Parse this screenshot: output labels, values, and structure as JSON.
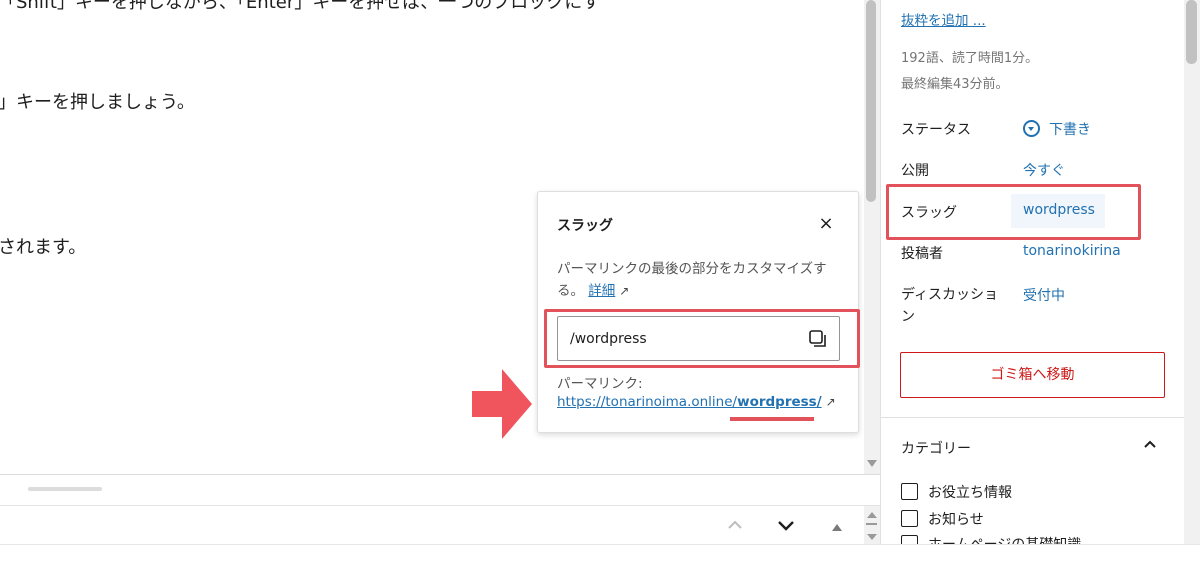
{
  "editor": {
    "line1": "「Shift」キーを押しながら、「Enter」キーを押せば、一つのブロックにす",
    "line2": "」キーを押しましょう。",
    "line3": "されます。"
  },
  "popover": {
    "title": "スラッグ",
    "close_icon": "×",
    "help_text": "パーマリンクの最後の部分をカスタマイズする。",
    "help_link": "詳細",
    "slug_value": "/wordpress",
    "permalink_label": "パーマリンク:",
    "permalink_base": "https://tonarinoima.online/",
    "permalink_slug": "wordpress/"
  },
  "sidebar": {
    "excerpt_link": "抜粋を追加 ...",
    "word_count": "192語、読了時間1分。",
    "last_edited": "最終編集43分前。",
    "rows": [
      {
        "label": "ステータス",
        "value": "下書き"
      },
      {
        "label": "公開",
        "value": "今すぐ"
      },
      {
        "label": "スラッグ",
        "value": "wordpress"
      },
      {
        "label": "投稿者",
        "value": "tonarinokirina"
      },
      {
        "label": "ディスカッション",
        "value": "受付中"
      }
    ],
    "trash_button": "ゴミ箱へ移動",
    "categories_title": "カテゴリー",
    "categories": [
      "お役立ち情報",
      "お知らせ",
      "ホームページの基礎知識"
    ]
  },
  "colors": {
    "accent": "#2271b1",
    "danger": "#cc1818",
    "annotation": "#e2525a"
  }
}
